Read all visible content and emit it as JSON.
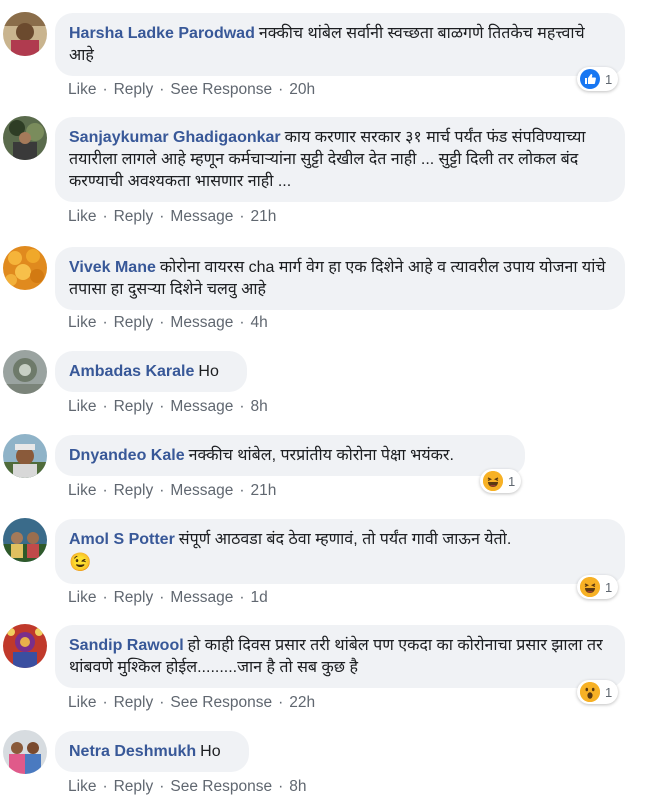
{
  "comments": [
    {
      "author": "Harsha Ladke Parodwad",
      "text": "नक्कीच थांबेल सर्वानी स्वच्छता बाळगणे तितकेच महत्त्वाचे आहे",
      "actions": [
        "Like",
        "Reply",
        "See Response"
      ],
      "time": "20h",
      "reaction": {
        "type": "like-icon",
        "count": "1"
      }
    },
    {
      "author": "Sanjaykumar Ghadigaonkar",
      "text": "काय करणार सरकार ३१ मार्च पर्यंत फंड संपविण्याच्या तयारीला लागले आहे म्हणून कर्मचाऱ्यांना सुट्टी देखील देत नाही ... सुट्टी दिली तर लोकल बंद करण्याची अवश्यकता भासणार नाही ...",
      "actions": [
        "Like",
        "Reply",
        "Message"
      ],
      "time": "21h"
    },
    {
      "author": "Vivek Mane",
      "text": "कोरोना वायरस cha मार्ग वेग हा एक दिशेने आहे व त्यावरील उपाय योजना यांचे तपासा हा दुसऱ्या दिशेने चलवु आहे",
      "actions": [
        "Like",
        "Reply",
        "Message"
      ],
      "time": "4h"
    },
    {
      "author": "Ambadas Karale",
      "text": "Ho",
      "actions": [
        "Like",
        "Reply",
        "Message"
      ],
      "time": "8h"
    },
    {
      "author": "Dnyandeo Kale",
      "text": "नक्कीच थांबेल, परप्रांतीय कोरोना पेक्षा भयंकर.",
      "actions": [
        "Like",
        "Reply",
        "Message"
      ],
      "time": "21h",
      "reaction": {
        "type": "haha-icon",
        "count": "1"
      }
    },
    {
      "author": "Amol S Potter",
      "text": "संपूर्ण आठवडा बंद ठेवा म्हणावं, तो पर्यंत गावी जाऊन येतो.",
      "emoji": "😉",
      "actions": [
        "Like",
        "Reply",
        "Message"
      ],
      "time": "1d",
      "reaction": {
        "type": "haha-icon",
        "count": "1"
      }
    },
    {
      "author": "Sandip Rawool",
      "text": "हो काही दिवस प्रसार तरी थांबेल पण एकदा का कोरोनाचा प्रसार झाला तर थांबवणे मुश्किल होईल.........जान है तो सब कुछ है",
      "actions": [
        "Like",
        "Reply",
        "See Response"
      ],
      "time": "22h",
      "reaction": {
        "type": "wow-icon",
        "count": "1"
      }
    },
    {
      "author": "Netra Deshmukh",
      "text": "Ho",
      "actions": [
        "Like",
        "Reply",
        "See Response"
      ],
      "time": "8h"
    }
  ],
  "colors": {
    "author": "#385898",
    "bubble": "#f0f2f5",
    "meta": "#606770",
    "like": "#1877f2",
    "emoji": "#f7b125"
  }
}
